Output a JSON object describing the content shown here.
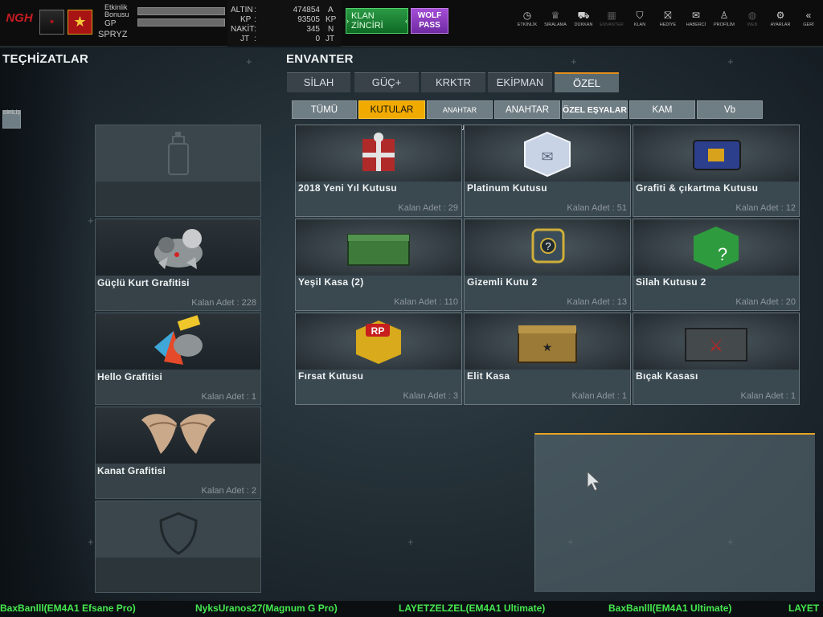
{
  "profile": {
    "logo_text": "NGH",
    "logo_sub": "DİRİLİŞ",
    "bonus_label_line1": "Etkinlik",
    "bonus_label_line2": "Bonusu",
    "gp_label": "GP",
    "username": "SPRYZ"
  },
  "currency": {
    "altin_label": "ALTIN",
    "altin_value": "474854",
    "altin_unit": "A",
    "kp_label": "KP",
    "kp_value": "93505",
    "kp_unit": "KP",
    "nakit_label": "NAKİT",
    "nakit_value": "345",
    "nakit_unit": "N",
    "jt_label": "JT",
    "jt_value": "0",
    "jt_unit": "JT"
  },
  "header_buttons": {
    "klan_zinciri": "KLAN ZİNCİRİ",
    "wolf_pass_line1": "WOLF",
    "wolf_pass_line2": "PASS"
  },
  "nav": [
    {
      "label": "ETKİNLİK",
      "icon": "stopwatch-icon",
      "glyph": "◷"
    },
    {
      "label": "SIRALAMA",
      "icon": "ranking-icon",
      "glyph": "♕"
    },
    {
      "label": "DÜKKAN",
      "icon": "cart-icon",
      "glyph": "⛟"
    },
    {
      "label": "ENVANTER",
      "icon": "inventory-icon",
      "glyph": "▦"
    },
    {
      "label": "KLAN",
      "icon": "shield-icon",
      "glyph": "⛉"
    },
    {
      "label": "HEDİYE",
      "icon": "gift-icon",
      "glyph": "⛝"
    },
    {
      "label": "HABERCİ",
      "icon": "megaphone-icon",
      "glyph": "✉"
    },
    {
      "label": "PROFİLİM",
      "icon": "profile-icon",
      "glyph": "♙"
    },
    {
      "label": "WEB",
      "icon": "globe-icon",
      "glyph": "◍"
    },
    {
      "label": "AYARLAR",
      "icon": "gear-icon",
      "glyph": "⚙"
    },
    {
      "label": "GERİ",
      "icon": "back-icon",
      "glyph": "«"
    }
  ],
  "equipment": {
    "title": "TEÇHİZATLAR",
    "slots": [
      {
        "name": "",
        "count": "",
        "icon": "spray-can-icon"
      },
      {
        "name": "Güçlü Kurt Grafitisi",
        "count": "Kalan Adet : 228",
        "icon": "wolf-graffiti-icon"
      },
      {
        "name": "Hello Grafitisi",
        "count": "Kalan Adet : 1",
        "icon": "hello-graffiti-icon"
      },
      {
        "name": "Kanat Grafitisi",
        "count": "Kalan Adet : 2",
        "icon": "wings-graffiti-icon"
      },
      {
        "name": "",
        "count": "",
        "icon": "shield-slot-icon"
      }
    ]
  },
  "inventory": {
    "title": "ENVANTER",
    "tabs": [
      "SİLAH",
      "GÜÇ+",
      "KRKTR",
      "EKİPMAN",
      "ÖZEL"
    ],
    "active_tab": "ÖZEL",
    "subtabs": [
      "TÜMÜ",
      "KUTULAR",
      "ANAHTAR KUTUSU",
      "ANAHTAR",
      "ÖZEL EŞYALAR",
      "KAM",
      "Vb"
    ],
    "active_subtab": "KUTULAR",
    "items": [
      {
        "name": "2018 Yeni Yıl Kutusu",
        "count": "Kalan Adet : 29",
        "icon": "gift-box-icon",
        "color": "#b02a2a"
      },
      {
        "name": "Platinum Kutusu",
        "count": "Kalan Adet : 51",
        "icon": "platinum-box-icon",
        "color": "#c9d3e6"
      },
      {
        "name": "Grafiti & çıkartma Kutusu",
        "count": "Kalan Adet : 12",
        "icon": "graffiti-case-icon",
        "color": "#2b3f8c"
      },
      {
        "name": "Yeşil Kasa (2)",
        "count": "Kalan Adet : 110",
        "icon": "green-crate-icon",
        "color": "#3e7a3a"
      },
      {
        "name": "Gizemli Kutu 2",
        "count": "Kalan Adet : 13",
        "icon": "mystery-box-icon",
        "color": "#3a4c5a"
      },
      {
        "name": "Silah Kutusu 2",
        "count": "Kalan Adet : 20",
        "icon": "weapon-box-icon",
        "color": "#2e9b3e"
      },
      {
        "name": "Fırsat Kutusu",
        "count": "Kalan Adet : 3",
        "icon": "rp-box-icon",
        "color": "#d8aa1c"
      },
      {
        "name": "Elit Kasa",
        "count": "Kalan Adet : 1",
        "icon": "elite-chest-icon",
        "color": "#9a7a36"
      },
      {
        "name": "Bıçak Kasası",
        "count": "Kalan Adet : 1",
        "icon": "knife-case-icon",
        "color": "#44494c"
      }
    ]
  },
  "ticker": [
    "BaxBanlll(EM4A1 Efsane Pro)",
    "NyksUranos27(Magnum G Pro)",
    "LAYETZELZEL(EM4A1 Ultimate)",
    "BaxBanlll(EM4A1 Ultimate)",
    "LAYET"
  ],
  "colors": {
    "accent": "#f0aa00",
    "ticker_text": "#46e84e",
    "klan_button": "#1f8a3a",
    "wolf_button": "#8e3ec2"
  }
}
